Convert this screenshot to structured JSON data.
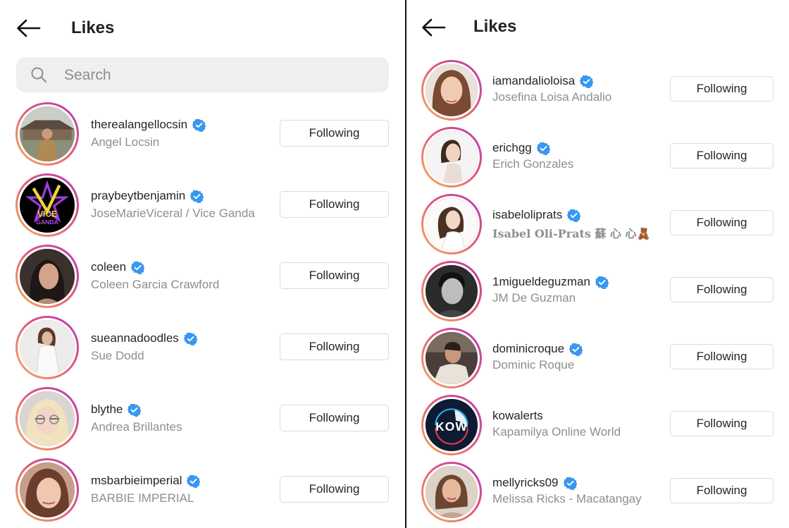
{
  "left": {
    "title": "Likes",
    "search_placeholder": "Search",
    "users": [
      {
        "username": "therealangellocsin",
        "fullname": "Angel Locsin",
        "verified": true,
        "button": "Following"
      },
      {
        "username": "praybeytbenjamin",
        "fullname": "JoseMarieViceral / Vice Ganda",
        "verified": true,
        "button": "Following"
      },
      {
        "username": "coleen",
        "fullname": "Coleen Garcia Crawford",
        "verified": true,
        "button": "Following"
      },
      {
        "username": "sueannadoodles",
        "fullname": "Sue Dodd",
        "verified": true,
        "button": "Following"
      },
      {
        "username": "blythe",
        "fullname": "Andrea Brillantes",
        "verified": true,
        "button": "Following"
      },
      {
        "username": "msbarbieimperial",
        "fullname": "BARBIE IMPERIAL",
        "verified": true,
        "button": "Following"
      }
    ]
  },
  "right": {
    "title": "Likes",
    "users": [
      {
        "username": "iamandalioloisa",
        "fullname": "Josefina Loisa Andalio",
        "verified": true,
        "button": "Following"
      },
      {
        "username": "erichgg",
        "fullname": "Erich Gonzales",
        "verified": true,
        "button": "Following"
      },
      {
        "username": "isabeloliprats",
        "fullname": "Isabel Oli-Prats 蘇 心 心🧸",
        "verified": true,
        "button": "Following"
      },
      {
        "username": "1migueldeguzman",
        "fullname": "JM De Guzman",
        "verified": true,
        "button": "Following"
      },
      {
        "username": "dominicroque",
        "fullname": "Dominic Roque",
        "verified": true,
        "button": "Following"
      },
      {
        "username": "kowalerts",
        "fullname": "Kapamilya Online World",
        "verified": false,
        "button": "Following"
      },
      {
        "username": "mellyricks09",
        "fullname": "Melissa Ricks - Macatangay",
        "verified": true,
        "button": "Following"
      }
    ]
  },
  "avatar_logo_text": {
    "vice_ganda": [
      "VICE",
      "GANDA"
    ],
    "kow": "KOW"
  },
  "colors": {
    "verified": "#3897f0",
    "secondary_text": "#8e8e8e",
    "search_bg": "#efefef",
    "button_border": "#dbdbdb"
  }
}
